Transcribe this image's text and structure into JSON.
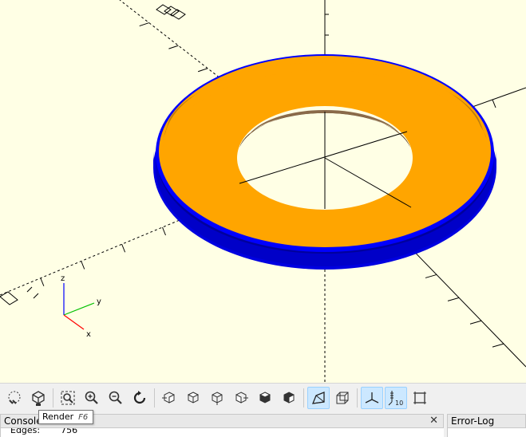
{
  "viewport": {
    "background": "#ffffe5",
    "model": {
      "description_color_top": "#ffa500",
      "side_color": "#0000ff"
    },
    "axes_indicator": {
      "z_label": "z",
      "y_label": "y",
      "x_label": "x",
      "colors": {
        "z": "#0000ff",
        "y": "#00c000",
        "x": "#ff0000"
      }
    }
  },
  "toolbar": {
    "buttons": [
      {
        "name": "preview-button",
        "icon": "preview-icon",
        "active": false
      },
      {
        "name": "render-button",
        "icon": "render-icon",
        "active": false
      },
      {
        "name": "view-all-button",
        "icon": "zoom-fit-icon",
        "active": false
      },
      {
        "name": "zoom-in-button",
        "icon": "zoom-in-icon",
        "active": false
      },
      {
        "name": "zoom-out-button",
        "icon": "zoom-out-icon",
        "active": false
      },
      {
        "name": "reset-view-button",
        "icon": "reset-view-icon",
        "active": false
      },
      {
        "name": "view-right-button",
        "icon": "view-right-icon",
        "active": false
      },
      {
        "name": "view-top-button",
        "icon": "view-top-icon",
        "active": false
      },
      {
        "name": "view-bottom-button",
        "icon": "view-bottom-icon",
        "active": false
      },
      {
        "name": "view-left-button",
        "icon": "view-left-icon",
        "active": false
      },
      {
        "name": "view-front-button",
        "icon": "view-front-icon",
        "active": false
      },
      {
        "name": "view-back-button",
        "icon": "view-back-icon",
        "active": false
      },
      {
        "name": "perspective-button",
        "icon": "perspective-icon",
        "active": true
      },
      {
        "name": "orthogonal-button",
        "icon": "orthogonal-icon",
        "active": false
      },
      {
        "name": "show-axes-button",
        "icon": "axes-icon",
        "active": true
      },
      {
        "name": "show-scale-markers-button",
        "icon": "scale-markers-icon",
        "active": true
      },
      {
        "name": "show-edges-button",
        "icon": "edges-icon",
        "active": false
      }
    ],
    "scale_marker_text": "10"
  },
  "tooltip": {
    "label": "Render",
    "shortcut": "F6"
  },
  "console": {
    "title": "Console",
    "close": "✕",
    "line_label": "Edges:",
    "line_value": "756"
  },
  "errorlog": {
    "title": "Error-Log"
  }
}
